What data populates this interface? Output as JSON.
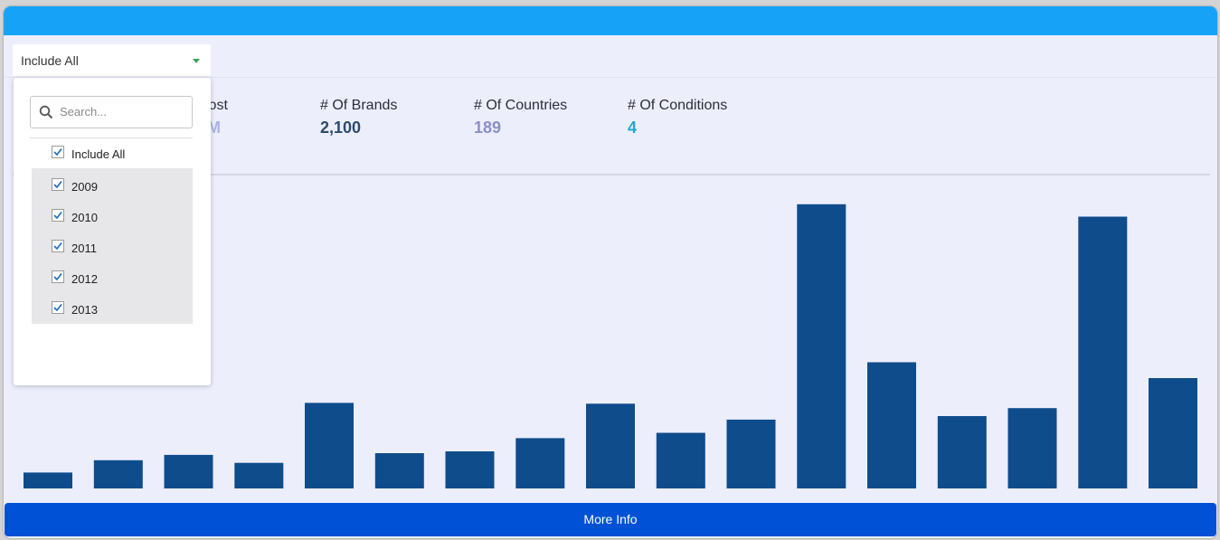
{
  "filter": {
    "selected_label": "Include All",
    "search_placeholder": "Search...",
    "options": [
      {
        "label": "Include All",
        "checked": true
      },
      {
        "label": "2009",
        "checked": true
      },
      {
        "label": "2010",
        "checked": true
      },
      {
        "label": "2011",
        "checked": true
      },
      {
        "label": "2012",
        "checked": true
      },
      {
        "label": "2013",
        "checked": true
      }
    ]
  },
  "kpis": [
    {
      "label": "Cost",
      "value": "3M",
      "color": "#a9b3e8"
    },
    {
      "label": "# Of Brands",
      "value": "2,100",
      "color": "#2c4a6e"
    },
    {
      "label": "# Of Countries",
      "value": "189",
      "color": "#8b8fc7"
    },
    {
      "label": "# Of Conditions",
      "value": "4",
      "color": "#1fa8d8"
    }
  ],
  "chart_data": {
    "type": "bar",
    "bar_color": "#0f4c8c",
    "values": [
      18,
      32,
      38,
      29,
      97,
      40,
      42,
      57,
      96,
      63,
      78,
      322,
      143,
      82,
      91,
      308,
      125
    ],
    "ylim": [
      0,
      330
    ]
  },
  "footer": {
    "more_info_label": "More Info"
  },
  "colors": {
    "top_bar": "#16a3f7",
    "panel_bg": "#eceefc",
    "button_bg": "#0051d6"
  }
}
